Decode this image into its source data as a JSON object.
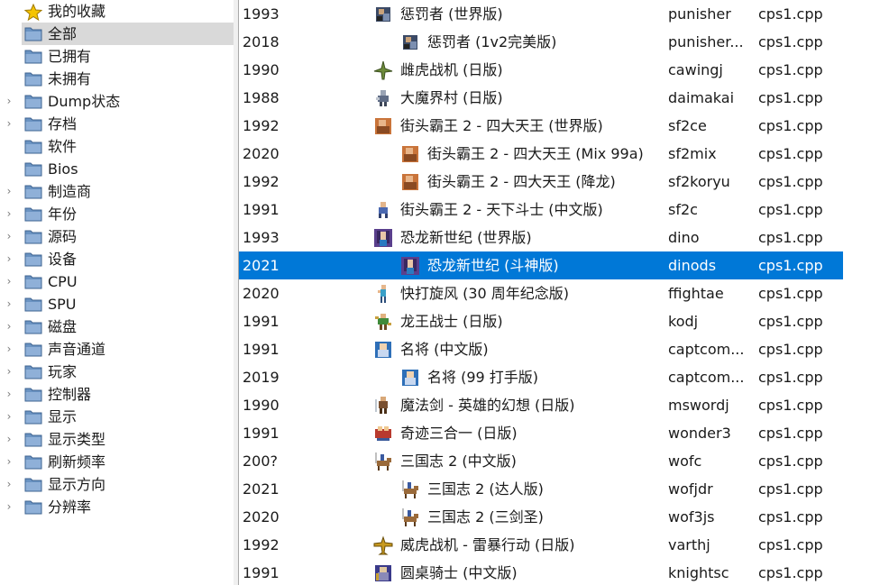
{
  "tree": {
    "items": [
      {
        "label": "我的收藏",
        "icon": "star-icon",
        "expandable": false,
        "selected": false
      },
      {
        "label": "全部",
        "icon": "folder-icon",
        "expandable": false,
        "selected": true
      },
      {
        "label": "已拥有",
        "icon": "folder-icon",
        "expandable": false,
        "selected": false
      },
      {
        "label": "未拥有",
        "icon": "folder-icon",
        "expandable": false,
        "selected": false
      },
      {
        "label": "Dump状态",
        "icon": "folder-icon",
        "expandable": true,
        "selected": false
      },
      {
        "label": "存档",
        "icon": "folder-icon",
        "expandable": true,
        "selected": false
      },
      {
        "label": "软件",
        "icon": "folder-icon",
        "expandable": false,
        "selected": false
      },
      {
        "label": "Bios",
        "icon": "folder-icon",
        "expandable": false,
        "selected": false
      },
      {
        "label": "制造商",
        "icon": "folder-icon",
        "expandable": true,
        "selected": false
      },
      {
        "label": "年份",
        "icon": "folder-icon",
        "expandable": true,
        "selected": false
      },
      {
        "label": "源码",
        "icon": "folder-icon",
        "expandable": true,
        "selected": false
      },
      {
        "label": "设备",
        "icon": "folder-icon",
        "expandable": true,
        "selected": false
      },
      {
        "label": "CPU",
        "icon": "folder-icon",
        "expandable": true,
        "selected": false
      },
      {
        "label": "SPU",
        "icon": "folder-icon",
        "expandable": true,
        "selected": false
      },
      {
        "label": "磁盘",
        "icon": "folder-icon",
        "expandable": true,
        "selected": false
      },
      {
        "label": "声音通道",
        "icon": "folder-icon",
        "expandable": true,
        "selected": false
      },
      {
        "label": "玩家",
        "icon": "folder-icon",
        "expandable": true,
        "selected": false
      },
      {
        "label": "控制器",
        "icon": "folder-icon",
        "expandable": true,
        "selected": false
      },
      {
        "label": "显示",
        "icon": "folder-icon",
        "expandable": true,
        "selected": false
      },
      {
        "label": "显示类型",
        "icon": "folder-icon",
        "expandable": true,
        "selected": false
      },
      {
        "label": "刷新频率",
        "icon": "folder-icon",
        "expandable": true,
        "selected": false
      },
      {
        "label": "显示方向",
        "icon": "folder-icon",
        "expandable": true,
        "selected": false
      },
      {
        "label": "分辨率",
        "icon": "folder-icon",
        "expandable": true,
        "selected": false
      }
    ]
  },
  "games": {
    "rows": [
      {
        "year": "1993",
        "name": "惩罚者 (世界版)",
        "rom": "punisher",
        "source": "cps1.cpp",
        "clone": false,
        "icon": "punisher-icon",
        "selected": false
      },
      {
        "year": "2018",
        "name": "惩罚者 (1v2完美版)",
        "rom": "punisher...",
        "source": "cps1.cpp",
        "clone": true,
        "icon": "punisher-icon",
        "selected": false
      },
      {
        "year": "1990",
        "name": "雌虎战机 (日版)",
        "rom": "cawingj",
        "source": "cps1.cpp",
        "clone": false,
        "icon": "jet-icon",
        "selected": false
      },
      {
        "year": "1988",
        "name": "大魔界村 (日版)",
        "rom": "daimakai",
        "source": "cps1.cpp",
        "clone": false,
        "icon": "knight-icon",
        "selected": false
      },
      {
        "year": "1992",
        "name": "街头霸王 2 - 四大天王 (世界版)",
        "rom": "sf2ce",
        "source": "cps1.cpp",
        "clone": false,
        "icon": "fighter-icon",
        "selected": false
      },
      {
        "year": "2020",
        "name": "街头霸王 2 - 四大天王 (Mix 99a)",
        "rom": "sf2mix",
        "source": "cps1.cpp",
        "clone": true,
        "icon": "fighter-icon",
        "selected": false
      },
      {
        "year": "1992",
        "name": "街头霸王 2 - 四大天王 (降龙)",
        "rom": "sf2koryu",
        "source": "cps1.cpp",
        "clone": true,
        "icon": "fighter-icon",
        "selected": false
      },
      {
        "year": "1991",
        "name": "街头霸王 2 - 天下斗士 (中文版)",
        "rom": "sf2c",
        "source": "cps1.cpp",
        "clone": false,
        "icon": "fighter-small-icon",
        "selected": false
      },
      {
        "year": "1993",
        "name": "恐龙新世纪 (世界版)",
        "rom": "dino",
        "source": "cps1.cpp",
        "clone": false,
        "icon": "dino-icon",
        "selected": false
      },
      {
        "year": "2021",
        "name": "恐龙新世纪 (斗神版)",
        "rom": "dinods",
        "source": "cps1.cpp",
        "clone": true,
        "icon": "dino-icon",
        "selected": true
      },
      {
        "year": "2020",
        "name": "快打旋风 (30 周年纪念版)",
        "rom": "ffightae",
        "source": "cps1.cpp",
        "clone": false,
        "icon": "brawler-icon",
        "selected": false
      },
      {
        "year": "1991",
        "name": "龙王战士 (日版)",
        "rom": "kodj",
        "source": "cps1.cpp",
        "clone": false,
        "icon": "warrior-icon",
        "selected": false
      },
      {
        "year": "1991",
        "name": "名将 (中文版)",
        "rom": "captcom...",
        "source": "cps1.cpp",
        "clone": false,
        "icon": "commando-icon",
        "selected": false
      },
      {
        "year": "2019",
        "name": "名将 (99 打手版)",
        "rom": "captcom...",
        "source": "cps1.cpp",
        "clone": true,
        "icon": "commando-icon",
        "selected": false
      },
      {
        "year": "1990",
        "name": "魔法剑 - 英雄的幻想 (日版)",
        "rom": "mswordj",
        "source": "cps1.cpp",
        "clone": false,
        "icon": "sword-icon",
        "selected": false
      },
      {
        "year": "1991",
        "name": "奇迹三合一 (日版)",
        "rom": "wonder3",
        "source": "cps1.cpp",
        "clone": false,
        "icon": "wonder-icon",
        "selected": false
      },
      {
        "year": "200?",
        "name": "三国志 2 (中文版)",
        "rom": "wofc",
        "source": "cps1.cpp",
        "clone": false,
        "icon": "horse-rider-icon",
        "selected": false
      },
      {
        "year": "2021",
        "name": "三国志 2 (达人版)",
        "rom": "wofjdr",
        "source": "cps1.cpp",
        "clone": true,
        "icon": "horse-rider-icon",
        "selected": false
      },
      {
        "year": "2020",
        "name": "三国志 2 (三剑圣)",
        "rom": "wof3js",
        "source": "cps1.cpp",
        "clone": true,
        "icon": "horse-rider-icon",
        "selected": false
      },
      {
        "year": "1992",
        "name": "威虎战机 - 雷暴行动 (日版)",
        "rom": "varthj",
        "source": "cps1.cpp",
        "clone": false,
        "icon": "plane-icon",
        "selected": false
      },
      {
        "year": "1991",
        "name": "圆桌骑士 (中文版)",
        "rom": "knightsc",
        "source": "cps1.cpp",
        "clone": false,
        "icon": "round-knight-icon",
        "selected": false
      }
    ]
  },
  "colors": {
    "selection": "#0078d7",
    "tree_selection": "#d9d9d9",
    "folder": "#5a84b5",
    "star": "#f5c400"
  }
}
